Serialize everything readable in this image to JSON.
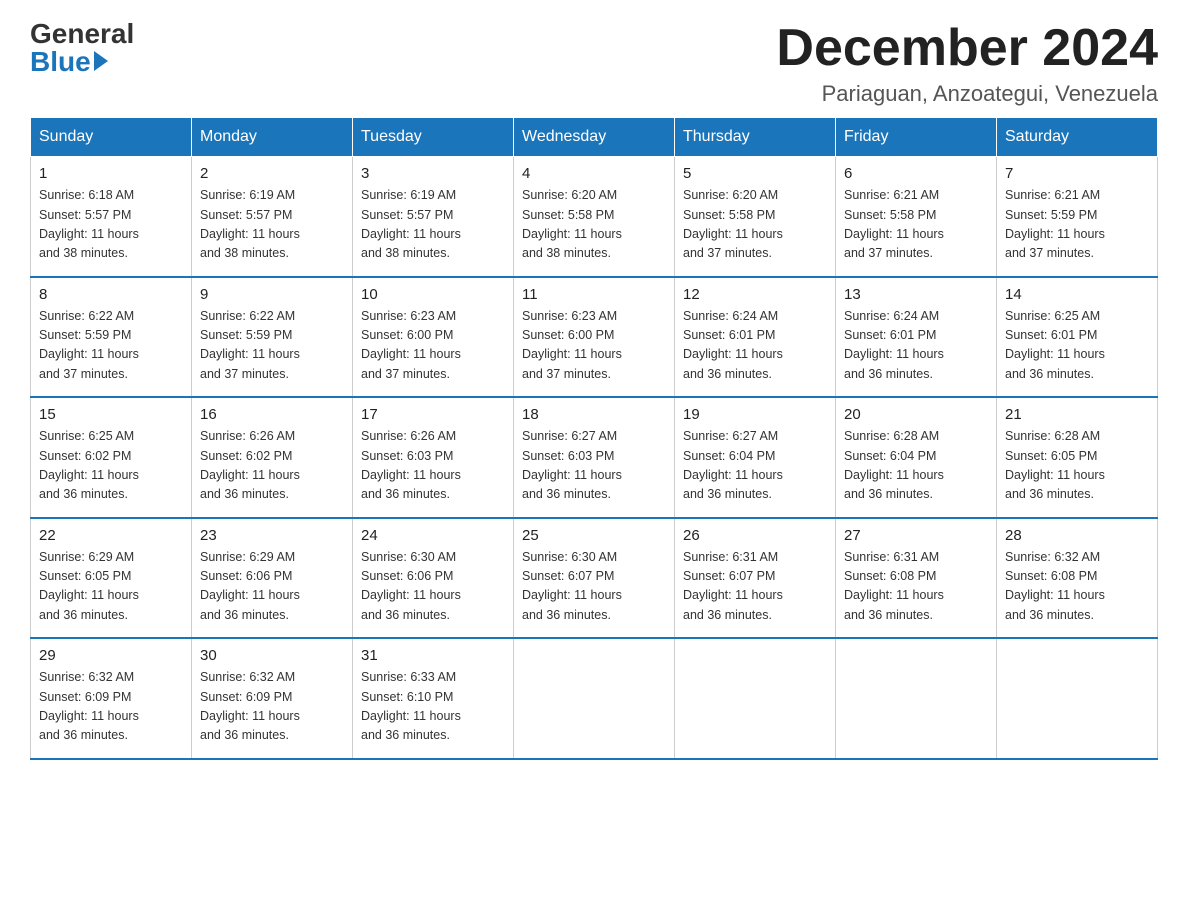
{
  "logo": {
    "general": "General",
    "blue": "Blue"
  },
  "title": "December 2024",
  "location": "Pariaguan, Anzoategui, Venezuela",
  "days_of_week": [
    "Sunday",
    "Monday",
    "Tuesday",
    "Wednesday",
    "Thursday",
    "Friday",
    "Saturday"
  ],
  "weeks": [
    [
      {
        "day": "1",
        "sunrise": "6:18 AM",
        "sunset": "5:57 PM",
        "daylight": "11 hours and 38 minutes."
      },
      {
        "day": "2",
        "sunrise": "6:19 AM",
        "sunset": "5:57 PM",
        "daylight": "11 hours and 38 minutes."
      },
      {
        "day": "3",
        "sunrise": "6:19 AM",
        "sunset": "5:57 PM",
        "daylight": "11 hours and 38 minutes."
      },
      {
        "day": "4",
        "sunrise": "6:20 AM",
        "sunset": "5:58 PM",
        "daylight": "11 hours and 38 minutes."
      },
      {
        "day": "5",
        "sunrise": "6:20 AM",
        "sunset": "5:58 PM",
        "daylight": "11 hours and 37 minutes."
      },
      {
        "day": "6",
        "sunrise": "6:21 AM",
        "sunset": "5:58 PM",
        "daylight": "11 hours and 37 minutes."
      },
      {
        "day": "7",
        "sunrise": "6:21 AM",
        "sunset": "5:59 PM",
        "daylight": "11 hours and 37 minutes."
      }
    ],
    [
      {
        "day": "8",
        "sunrise": "6:22 AM",
        "sunset": "5:59 PM",
        "daylight": "11 hours and 37 minutes."
      },
      {
        "day": "9",
        "sunrise": "6:22 AM",
        "sunset": "5:59 PM",
        "daylight": "11 hours and 37 minutes."
      },
      {
        "day": "10",
        "sunrise": "6:23 AM",
        "sunset": "6:00 PM",
        "daylight": "11 hours and 37 minutes."
      },
      {
        "day": "11",
        "sunrise": "6:23 AM",
        "sunset": "6:00 PM",
        "daylight": "11 hours and 37 minutes."
      },
      {
        "day": "12",
        "sunrise": "6:24 AM",
        "sunset": "6:01 PM",
        "daylight": "11 hours and 36 minutes."
      },
      {
        "day": "13",
        "sunrise": "6:24 AM",
        "sunset": "6:01 PM",
        "daylight": "11 hours and 36 minutes."
      },
      {
        "day": "14",
        "sunrise": "6:25 AM",
        "sunset": "6:01 PM",
        "daylight": "11 hours and 36 minutes."
      }
    ],
    [
      {
        "day": "15",
        "sunrise": "6:25 AM",
        "sunset": "6:02 PM",
        "daylight": "11 hours and 36 minutes."
      },
      {
        "day": "16",
        "sunrise": "6:26 AM",
        "sunset": "6:02 PM",
        "daylight": "11 hours and 36 minutes."
      },
      {
        "day": "17",
        "sunrise": "6:26 AM",
        "sunset": "6:03 PM",
        "daylight": "11 hours and 36 minutes."
      },
      {
        "day": "18",
        "sunrise": "6:27 AM",
        "sunset": "6:03 PM",
        "daylight": "11 hours and 36 minutes."
      },
      {
        "day": "19",
        "sunrise": "6:27 AM",
        "sunset": "6:04 PM",
        "daylight": "11 hours and 36 minutes."
      },
      {
        "day": "20",
        "sunrise": "6:28 AM",
        "sunset": "6:04 PM",
        "daylight": "11 hours and 36 minutes."
      },
      {
        "day": "21",
        "sunrise": "6:28 AM",
        "sunset": "6:05 PM",
        "daylight": "11 hours and 36 minutes."
      }
    ],
    [
      {
        "day": "22",
        "sunrise": "6:29 AM",
        "sunset": "6:05 PM",
        "daylight": "11 hours and 36 minutes."
      },
      {
        "day": "23",
        "sunrise": "6:29 AM",
        "sunset": "6:06 PM",
        "daylight": "11 hours and 36 minutes."
      },
      {
        "day": "24",
        "sunrise": "6:30 AM",
        "sunset": "6:06 PM",
        "daylight": "11 hours and 36 minutes."
      },
      {
        "day": "25",
        "sunrise": "6:30 AM",
        "sunset": "6:07 PM",
        "daylight": "11 hours and 36 minutes."
      },
      {
        "day": "26",
        "sunrise": "6:31 AM",
        "sunset": "6:07 PM",
        "daylight": "11 hours and 36 minutes."
      },
      {
        "day": "27",
        "sunrise": "6:31 AM",
        "sunset": "6:08 PM",
        "daylight": "11 hours and 36 minutes."
      },
      {
        "day": "28",
        "sunrise": "6:32 AM",
        "sunset": "6:08 PM",
        "daylight": "11 hours and 36 minutes."
      }
    ],
    [
      {
        "day": "29",
        "sunrise": "6:32 AM",
        "sunset": "6:09 PM",
        "daylight": "11 hours and 36 minutes."
      },
      {
        "day": "30",
        "sunrise": "6:32 AM",
        "sunset": "6:09 PM",
        "daylight": "11 hours and 36 minutes."
      },
      {
        "day": "31",
        "sunrise": "6:33 AM",
        "sunset": "6:10 PM",
        "daylight": "11 hours and 36 minutes."
      },
      null,
      null,
      null,
      null
    ]
  ],
  "labels": {
    "sunrise": "Sunrise:",
    "sunset": "Sunset:",
    "daylight": "Daylight:"
  }
}
